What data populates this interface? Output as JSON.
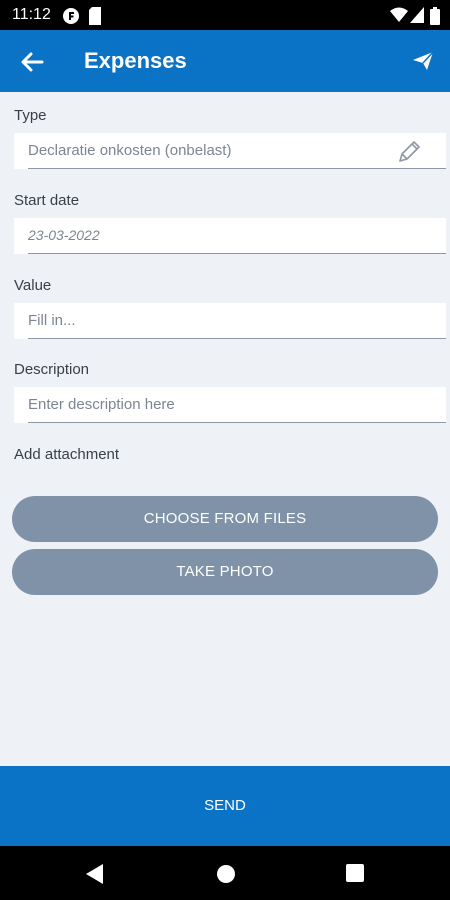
{
  "status_bar": {
    "time": "11:12"
  },
  "app_bar": {
    "title": "Expenses"
  },
  "form": {
    "type": {
      "label": "Type",
      "value": "Declaratie onkosten (onbelast)"
    },
    "start_date": {
      "label": "Start date",
      "value": "23-03-2022"
    },
    "value": {
      "label": "Value",
      "placeholder": "Fill in..."
    },
    "description": {
      "label": "Description",
      "placeholder": "Enter description here"
    },
    "attachment": {
      "label": "Add attachment",
      "choose_button": "CHOOSE FROM FILES",
      "photo_button": "TAKE PHOTO"
    }
  },
  "send_button": "SEND",
  "icons": {
    "back": "arrow-left-icon",
    "send": "paper-plane-icon",
    "edit": "pencil-icon"
  },
  "colors": {
    "primary": "#0a73c6",
    "secondary_button": "#7f92a8",
    "background": "#eef1f6"
  }
}
